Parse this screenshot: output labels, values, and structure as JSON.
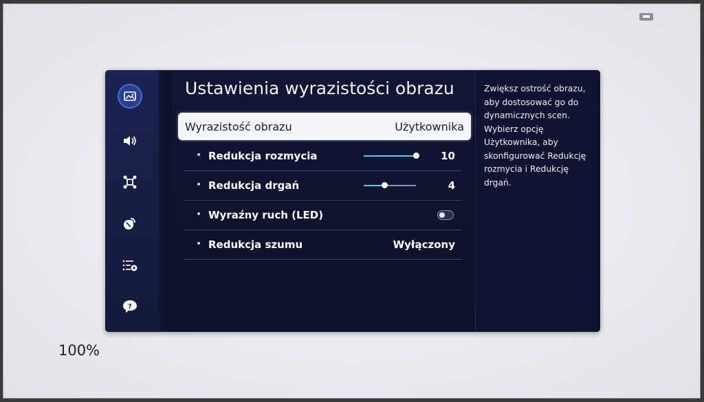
{
  "zoom": "100%",
  "menu": {
    "title": "Ustawienia wyrazistości obrazu",
    "selected": {
      "label": "Wyrazistość obrazu",
      "value": "Użytkownika"
    },
    "rows": [
      {
        "label": "Redukcja rozmycia",
        "value": "10",
        "control": "slider",
        "level": 1.0
      },
      {
        "label": "Redukcja drgań",
        "value": "4",
        "control": "slider",
        "level": 0.4
      },
      {
        "label": "Wyraźny ruch (LED)",
        "value": "",
        "control": "toggle",
        "state": "off"
      },
      {
        "label": "Redukcja szumu",
        "value": "Wyłączony",
        "control": "text"
      }
    ]
  },
  "help": "Zwiększ ostrość obrazu, aby dostosować go do dynamicznych scen. Wybierz opcję Użytkownika, aby skonfigurować Redukcję rozmycia i Redukcję drgań.",
  "rail_icons": [
    "picture-icon",
    "sound-icon",
    "connection-icon",
    "broadcasting-icon",
    "general-settings-icon",
    "support-icon"
  ],
  "colors": {
    "accent": "#5ec3ff",
    "panel": "#0d1128",
    "selected_bg": "#f4f5f8"
  }
}
